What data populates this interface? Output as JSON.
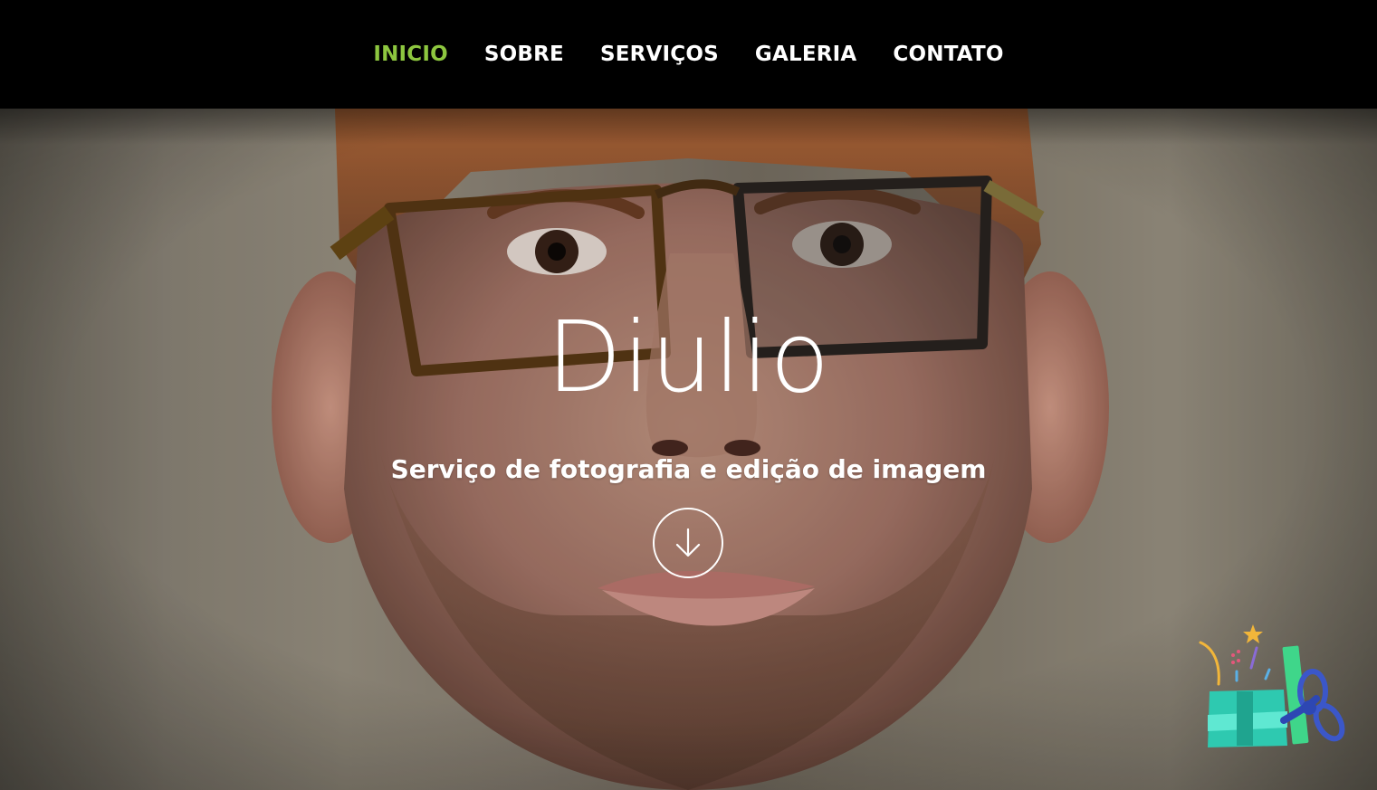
{
  "nav": {
    "items": [
      {
        "label": "INICIO",
        "active": true
      },
      {
        "label": "SOBRE",
        "active": false
      },
      {
        "label": "SERVIÇOS",
        "active": false
      },
      {
        "label": "GALERIA",
        "active": false
      },
      {
        "label": "CONTATO",
        "active": false
      }
    ],
    "active_color": "#8dc63f"
  },
  "hero": {
    "title": "Diulio",
    "subtitle": "Serviço de fotografia e edição de imagem",
    "scroll_icon": "arrow-down-circle-icon",
    "background_image": "portrait-photo-man-with-glasses"
  },
  "widget": {
    "icon": "gift-box-icon"
  }
}
